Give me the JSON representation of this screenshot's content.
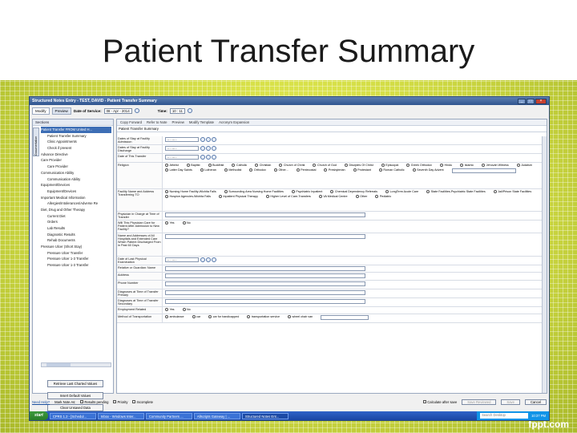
{
  "slide": {
    "title": "Patient Transfer Summary",
    "watermark": "fppt.com"
  },
  "window": {
    "title": "Structured Notes Entry - TEST, DAVID - Patient Transfer Summary"
  },
  "topbar": {
    "tabs": [
      "Modify",
      "Preview"
    ],
    "date_label": "Date of Service:",
    "date_value": "08 - Apr - 2014",
    "time_label": "Time:",
    "time_value": "10 : 11"
  },
  "left_panel": {
    "sections_label": "Sections",
    "side_tab": "Documentation",
    "tree": [
      "Patient Transfer FROM United H...",
      "Patient Transfer Summary",
      "Clinic Appointments",
      "Check if present",
      "Advance Directive",
      "Care Provider",
      "Care Provider",
      "Communication Ability",
      "Communication Ability",
      "Equipment/Devices",
      "Equipment/Devices",
      "Important Medical Information",
      "Allergies/Intolerances/Adverse Re",
      "Diet, Drug and Other Therapy",
      "Current Diet",
      "Orders",
      "Lab Results",
      "Diagnostic Results",
      "Rehab Documents",
      "Pressure Ulcer (Short Stay)",
      "Pressure Ulcer Transfer",
      "Pressure Ulcer 1-3 Transfer",
      "Pressure Ulcer 1-3 Transfer"
    ],
    "buttons": [
      "Retrieve Last Charted Values",
      "Insert Default Values",
      "Clear Unsaved Data"
    ]
  },
  "main_toolbar": [
    "Copy Forward",
    "Refer to Note",
    "Preview",
    "Modify Template",
    "Acronym Expansion"
  ],
  "note_title": "Patient Transfer Summary",
  "form_rows": [
    {
      "label": "Dates of Stay at Facility Admission",
      "type": "date",
      "value": "-- - --- -"
    },
    {
      "label": "Dates of Stay at Facility Discharge",
      "type": "date",
      "value": "-- - --- -"
    },
    {
      "label": "Date of This Transfer",
      "type": "date",
      "value": "-- - --- -"
    },
    {
      "label": "Religion",
      "type": "radio",
      "options": [
        "Atheist",
        "Baptist",
        "Buddhist",
        "Catholic",
        "Christian",
        "Church of Christ",
        "Church of God",
        "Disciples Of Christ",
        "Episcopal",
        "Greek Orthodox",
        "Hindu",
        "Islamic",
        "Jehovah Witness",
        "Judaism",
        "Latter Day Saints",
        "Lutheran",
        "Methodist",
        "Orthodox",
        "Other...",
        "Pentecostal",
        "Presbyterian",
        "Protestant",
        "Roman Catholic",
        "Seventh Day Advent"
      ]
    },
    {
      "label": "Facility Name and Address Transferring TO",
      "type": "radio",
      "options": [
        "Nursing Home Facility-Wichita Falls",
        "Surrounding Area Nursing Home Facilities",
        "Psychiatric Inpatient",
        "Chemical Dependency Referrals",
        "LongTerm Acute Care",
        "State Facilities-Psychiatric State Facilities",
        "Jail/Prison State Facilities",
        "Hospice Agencies-Wichita Falls",
        "Inpatient Physical Therapy",
        "Higher Level of Care-Transfers",
        "VA Medical Centre",
        "Other",
        "Pediatric"
      ]
    },
    {
      "label": "Physician in Charge at Time of Transfer",
      "type": "text"
    },
    {
      "label": "Will This Physician Care for Patient After Admission to New Facility?",
      "type": "radio",
      "options": [
        "Yes",
        "No"
      ]
    },
    {
      "label": "Name and Addresses of All Hospitals and Extended Care Which Patient Discharged From in Past 60 Days",
      "type": "text"
    },
    {
      "label": "Date of Last Physical Examination",
      "type": "date",
      "value": "-- - --- -"
    },
    {
      "label": "Relative or Guardian: Name",
      "type": "text"
    },
    {
      "label": "Address",
      "type": "text"
    },
    {
      "label": "Phone Number",
      "type": "text"
    },
    {
      "label": "Diagnoses at Time of Transfer Primary",
      "type": "text"
    },
    {
      "label": "Diagnoses at Time of Transfer Secondary",
      "type": "text"
    },
    {
      "label": "Employment Related",
      "type": "radio",
      "options": [
        "Yes",
        "No"
      ]
    },
    {
      "label": "Method of Transportation",
      "type": "radio",
      "options": [
        "ambulance",
        "car",
        "car for handicapped",
        "transportation service",
        "wheel chair van"
      ]
    }
  ],
  "bottom_bar": {
    "help": "Need Help?",
    "mark_note_as": "Mark Note As:",
    "checks": [
      "Results pending",
      "Priority",
      "Incomplete"
    ],
    "calc_after_save": "Calculate after save",
    "buttons": [
      "Save Reviewed",
      "Save",
      "Cancel"
    ]
  },
  "taskbar": {
    "start": "start",
    "tasks": [
      "CPRS 1.2 - [Schedul...",
      "Inbox - Windows Inter...",
      "Community Partners ...",
      "Allscripts Gateway | ...",
      "Structured Notes Ent..."
    ],
    "search_placeholder": "Search Desktop",
    "clock": "10:37 PM"
  }
}
